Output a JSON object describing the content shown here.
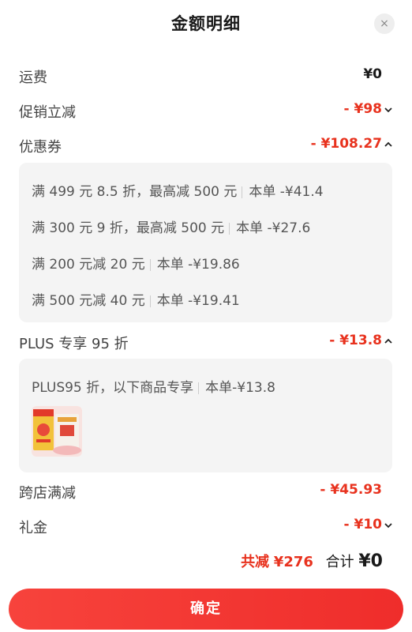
{
  "header": {
    "title": "金额明细",
    "close_glyph": "×"
  },
  "rows": {
    "shipping": {
      "label": "运费",
      "value": "¥0"
    },
    "promo": {
      "label": "促销立减",
      "value": "- ¥98"
    },
    "coupon": {
      "label": "优惠券",
      "value": "- ¥108.27"
    },
    "plus": {
      "label": "PLUS 专享 95 折",
      "value": "- ¥13.8"
    },
    "cross_store": {
      "label": "跨店满减",
      "value": "- ¥45.93"
    },
    "gift": {
      "label": "礼金",
      "value": "- ¥10"
    }
  },
  "coupon_details": [
    {
      "rule": "满 499 元 8.5 折，最高减 500 元",
      "amount": "本单 -¥41.4"
    },
    {
      "rule": "满 300 元 9 折，最高减 500 元",
      "amount": "本单 -¥27.6"
    },
    {
      "rule": "满 200 元减 20 元",
      "amount": "本单 -¥19.86"
    },
    {
      "rule": "满 500 元减 40 元",
      "amount": "本单 -¥19.41"
    }
  ],
  "plus_detail": {
    "rule": "PLUS95 折，以下商品专享",
    "amount": "本单-¥13.8"
  },
  "footer": {
    "saved_label": "共减",
    "saved_value": "¥276",
    "total_label": "合计",
    "total_value": "¥0",
    "confirm_label": "确定"
  },
  "colors": {
    "accent": "#e8321e",
    "button": "#f23c34",
    "panel": "#f4f4f4"
  }
}
